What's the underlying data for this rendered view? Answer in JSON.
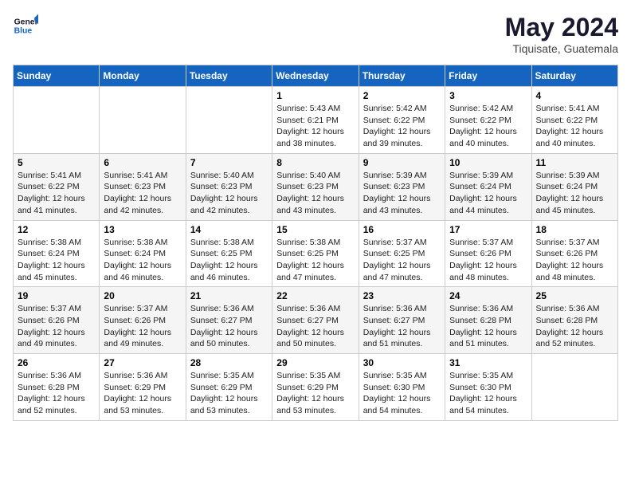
{
  "header": {
    "logo_line1": "General",
    "logo_line2": "Blue",
    "month_year": "May 2024",
    "location": "Tiquisate, Guatemala"
  },
  "weekdays": [
    "Sunday",
    "Monday",
    "Tuesday",
    "Wednesday",
    "Thursday",
    "Friday",
    "Saturday"
  ],
  "weeks": [
    [
      {
        "day": "",
        "info": ""
      },
      {
        "day": "",
        "info": ""
      },
      {
        "day": "",
        "info": ""
      },
      {
        "day": "1",
        "info": "Sunrise: 5:43 AM\nSunset: 6:21 PM\nDaylight: 12 hours\nand 38 minutes."
      },
      {
        "day": "2",
        "info": "Sunrise: 5:42 AM\nSunset: 6:22 PM\nDaylight: 12 hours\nand 39 minutes."
      },
      {
        "day": "3",
        "info": "Sunrise: 5:42 AM\nSunset: 6:22 PM\nDaylight: 12 hours\nand 40 minutes."
      },
      {
        "day": "4",
        "info": "Sunrise: 5:41 AM\nSunset: 6:22 PM\nDaylight: 12 hours\nand 40 minutes."
      }
    ],
    [
      {
        "day": "5",
        "info": "Sunrise: 5:41 AM\nSunset: 6:22 PM\nDaylight: 12 hours\nand 41 minutes."
      },
      {
        "day": "6",
        "info": "Sunrise: 5:41 AM\nSunset: 6:23 PM\nDaylight: 12 hours\nand 42 minutes."
      },
      {
        "day": "7",
        "info": "Sunrise: 5:40 AM\nSunset: 6:23 PM\nDaylight: 12 hours\nand 42 minutes."
      },
      {
        "day": "8",
        "info": "Sunrise: 5:40 AM\nSunset: 6:23 PM\nDaylight: 12 hours\nand 43 minutes."
      },
      {
        "day": "9",
        "info": "Sunrise: 5:39 AM\nSunset: 6:23 PM\nDaylight: 12 hours\nand 43 minutes."
      },
      {
        "day": "10",
        "info": "Sunrise: 5:39 AM\nSunset: 6:24 PM\nDaylight: 12 hours\nand 44 minutes."
      },
      {
        "day": "11",
        "info": "Sunrise: 5:39 AM\nSunset: 6:24 PM\nDaylight: 12 hours\nand 45 minutes."
      }
    ],
    [
      {
        "day": "12",
        "info": "Sunrise: 5:38 AM\nSunset: 6:24 PM\nDaylight: 12 hours\nand 45 minutes."
      },
      {
        "day": "13",
        "info": "Sunrise: 5:38 AM\nSunset: 6:24 PM\nDaylight: 12 hours\nand 46 minutes."
      },
      {
        "day": "14",
        "info": "Sunrise: 5:38 AM\nSunset: 6:25 PM\nDaylight: 12 hours\nand 46 minutes."
      },
      {
        "day": "15",
        "info": "Sunrise: 5:38 AM\nSunset: 6:25 PM\nDaylight: 12 hours\nand 47 minutes."
      },
      {
        "day": "16",
        "info": "Sunrise: 5:37 AM\nSunset: 6:25 PM\nDaylight: 12 hours\nand 47 minutes."
      },
      {
        "day": "17",
        "info": "Sunrise: 5:37 AM\nSunset: 6:26 PM\nDaylight: 12 hours\nand 48 minutes."
      },
      {
        "day": "18",
        "info": "Sunrise: 5:37 AM\nSunset: 6:26 PM\nDaylight: 12 hours\nand 48 minutes."
      }
    ],
    [
      {
        "day": "19",
        "info": "Sunrise: 5:37 AM\nSunset: 6:26 PM\nDaylight: 12 hours\nand 49 minutes."
      },
      {
        "day": "20",
        "info": "Sunrise: 5:37 AM\nSunset: 6:26 PM\nDaylight: 12 hours\nand 49 minutes."
      },
      {
        "day": "21",
        "info": "Sunrise: 5:36 AM\nSunset: 6:27 PM\nDaylight: 12 hours\nand 50 minutes."
      },
      {
        "day": "22",
        "info": "Sunrise: 5:36 AM\nSunset: 6:27 PM\nDaylight: 12 hours\nand 50 minutes."
      },
      {
        "day": "23",
        "info": "Sunrise: 5:36 AM\nSunset: 6:27 PM\nDaylight: 12 hours\nand 51 minutes."
      },
      {
        "day": "24",
        "info": "Sunrise: 5:36 AM\nSunset: 6:28 PM\nDaylight: 12 hours\nand 51 minutes."
      },
      {
        "day": "25",
        "info": "Sunrise: 5:36 AM\nSunset: 6:28 PM\nDaylight: 12 hours\nand 52 minutes."
      }
    ],
    [
      {
        "day": "26",
        "info": "Sunrise: 5:36 AM\nSunset: 6:28 PM\nDaylight: 12 hours\nand 52 minutes."
      },
      {
        "day": "27",
        "info": "Sunrise: 5:36 AM\nSunset: 6:29 PM\nDaylight: 12 hours\nand 53 minutes."
      },
      {
        "day": "28",
        "info": "Sunrise: 5:35 AM\nSunset: 6:29 PM\nDaylight: 12 hours\nand 53 minutes."
      },
      {
        "day": "29",
        "info": "Sunrise: 5:35 AM\nSunset: 6:29 PM\nDaylight: 12 hours\nand 53 minutes."
      },
      {
        "day": "30",
        "info": "Sunrise: 5:35 AM\nSunset: 6:30 PM\nDaylight: 12 hours\nand 54 minutes."
      },
      {
        "day": "31",
        "info": "Sunrise: 5:35 AM\nSunset: 6:30 PM\nDaylight: 12 hours\nand 54 minutes."
      },
      {
        "day": "",
        "info": ""
      }
    ]
  ]
}
